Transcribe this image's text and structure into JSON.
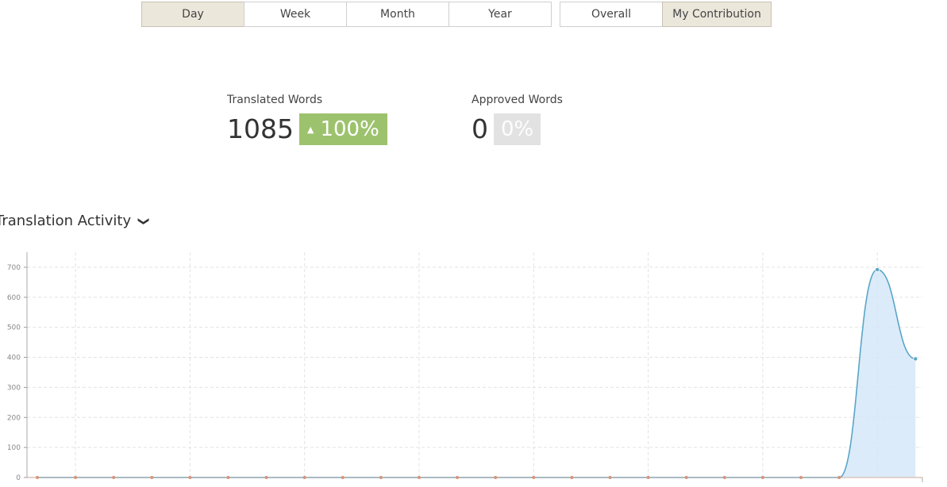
{
  "period_tabs": [
    "Day",
    "Week",
    "Month",
    "Year"
  ],
  "period_active": "Day",
  "scope_tabs": [
    "Overall",
    "My Contribution"
  ],
  "scope_active": "My Contribution",
  "stats": {
    "translated": {
      "label": "Translated Words",
      "value": "1085",
      "badge": "100%",
      "trend": "up",
      "trend_icon": "▲"
    },
    "approved": {
      "label": "Approved Words",
      "value": "0",
      "badge": "0%"
    }
  },
  "section": {
    "title": "Translation Activity",
    "chevron": "❯"
  },
  "colors": {
    "accent_green": "#9dc26d",
    "line": "#5aa5c8",
    "fill": "#d6e8f8",
    "active_tab": "#ebe7db"
  },
  "chart_data": {
    "type": "area",
    "ylim": [
      0,
      750
    ],
    "yticks": [
      0,
      100,
      200,
      300,
      400,
      500,
      600,
      700
    ],
    "x_points": 24,
    "values": [
      0,
      0,
      0,
      0,
      0,
      0,
      0,
      0,
      0,
      0,
      0,
      0,
      0,
      0,
      0,
      0,
      0,
      0,
      0,
      0,
      0,
      0,
      692,
      395
    ],
    "xlabel": "",
    "ylabel": "",
    "grid": true
  }
}
